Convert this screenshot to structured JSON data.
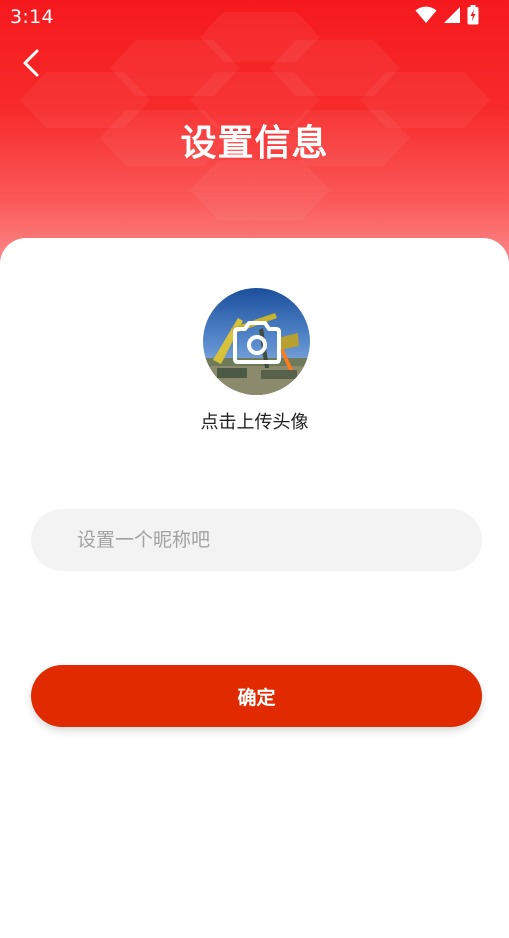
{
  "status_bar": {
    "time": "3:14",
    "icons": [
      "wifi-icon",
      "cellular-signal-icon",
      "battery-charging-icon"
    ]
  },
  "header": {
    "title": "设置信息",
    "back_icon": "chevron-left-icon"
  },
  "avatar": {
    "overlay_icon": "camera-icon",
    "caption": "点击上传头像"
  },
  "nickname": {
    "value": "",
    "placeholder": "设置一个昵称吧"
  },
  "confirm": {
    "label": "确定"
  },
  "colors": {
    "header_red": "#f5191d",
    "button_red": "#e12a00",
    "input_bg": "#f3f3f3"
  }
}
